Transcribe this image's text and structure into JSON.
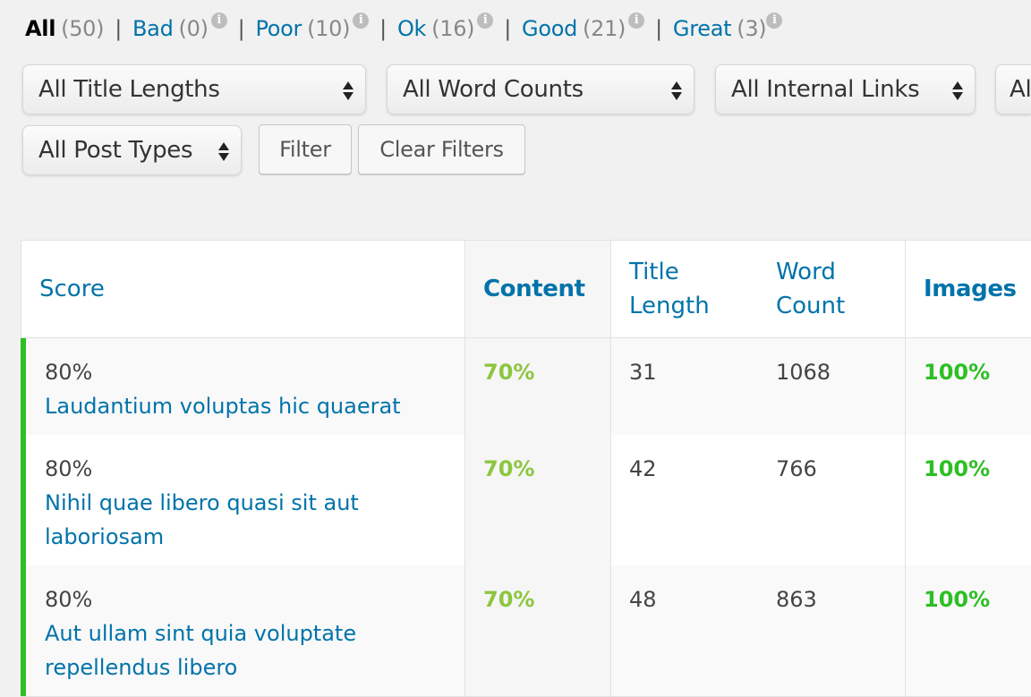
{
  "status_filters": [
    {
      "label": "All",
      "count": "(50)",
      "info": false
    },
    {
      "label": "Bad",
      "count": "(0)",
      "info": true
    },
    {
      "label": "Poor",
      "count": "(10)",
      "info": true
    },
    {
      "label": "Ok",
      "count": "(16)",
      "info": true
    },
    {
      "label": "Good",
      "count": "(21)",
      "info": true
    },
    {
      "label": "Great",
      "count": "(3)",
      "info": true
    }
  ],
  "separator": "|",
  "info_glyph": "i",
  "filters": {
    "title_lengths": "All Title Lengths",
    "word_counts": "All Word Counts",
    "internal_links": "All Internal Links",
    "fourth": "Al",
    "post_types": "All Post Types",
    "filter_button": "Filter",
    "clear_button": "Clear Filters"
  },
  "table": {
    "headers": {
      "score": "Score",
      "content": "Content",
      "title_length_1": "Title",
      "title_length_2": "Length",
      "word_count_1": "Word",
      "word_count_2": "Count",
      "images": "Images"
    },
    "rows": [
      {
        "score": "80%",
        "title": "Laudantium voluptas hic quaerat",
        "content": "70%",
        "title_length": "31",
        "word_count": "1068",
        "images": "100%"
      },
      {
        "score": "80%",
        "title": "Nihil quae libero quasi sit aut laboriosam",
        "content": "70%",
        "title_length": "42",
        "word_count": "766",
        "images": "100%"
      },
      {
        "score": "80%",
        "title": "Aut ullam sint quia voluptate repellendus libero",
        "content": "70%",
        "title_length": "48",
        "word_count": "863",
        "images": "100%"
      }
    ]
  },
  "colors": {
    "link": "#0073aa",
    "ok": "#8dc63f",
    "great": "#2ebf24",
    "score_bar": "#2ebf24"
  }
}
